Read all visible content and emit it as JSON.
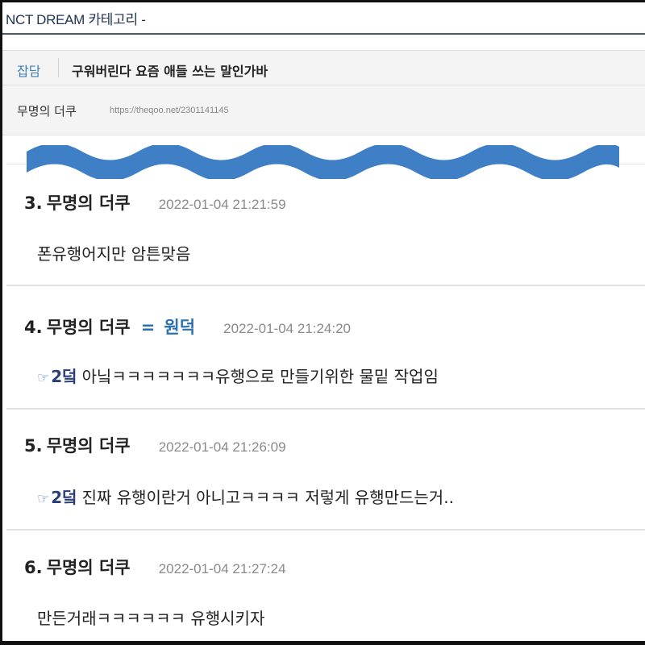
{
  "category_bar": {
    "label": "NCT DREAM 카테고리 -"
  },
  "post": {
    "category": "잡담",
    "title": "구워버린다 요즘 애들 쓰는 말인가바",
    "author": "무명의 더쿠",
    "url": "https://theqoo.net/2301141145"
  },
  "colors": {
    "wave": "#3f7fc6",
    "accent": "#2b70b0",
    "reply_tag": "#2a3f78",
    "divider": "#e2e2e2"
  },
  "comments": [
    {
      "number": "3.",
      "author": "무명의 더쿠",
      "timestamp": "2022-01-04 21:21:59",
      "text": "폰유행어지만 암튼맞음"
    },
    {
      "number": "4.",
      "author": "무명의 더쿠",
      "op_marker": "=",
      "op_label": "원덕",
      "timestamp": "2022-01-04 21:24:20",
      "reply_icon": "☞",
      "reply_to": "2덬",
      "text": "아닠ㅋㅋㅋㅋㅋㅋㅋ유행으로 만들기위한 물밑 작업임"
    },
    {
      "number": "5.",
      "author": "무명의 더쿠",
      "timestamp": "2022-01-04 21:26:09",
      "reply_icon": "☞",
      "reply_to": "2덬",
      "text": "진짜 유행이란거 아니고ㅋㅋㅋㅋ 저렇게 유행만드는거.."
    },
    {
      "number": "6.",
      "author": "무명의 더쿠",
      "timestamp": "2022-01-04 21:27:24",
      "text": "만든거래ㅋㅋㅋㅋㅋㅋ 유행시키자"
    }
  ]
}
